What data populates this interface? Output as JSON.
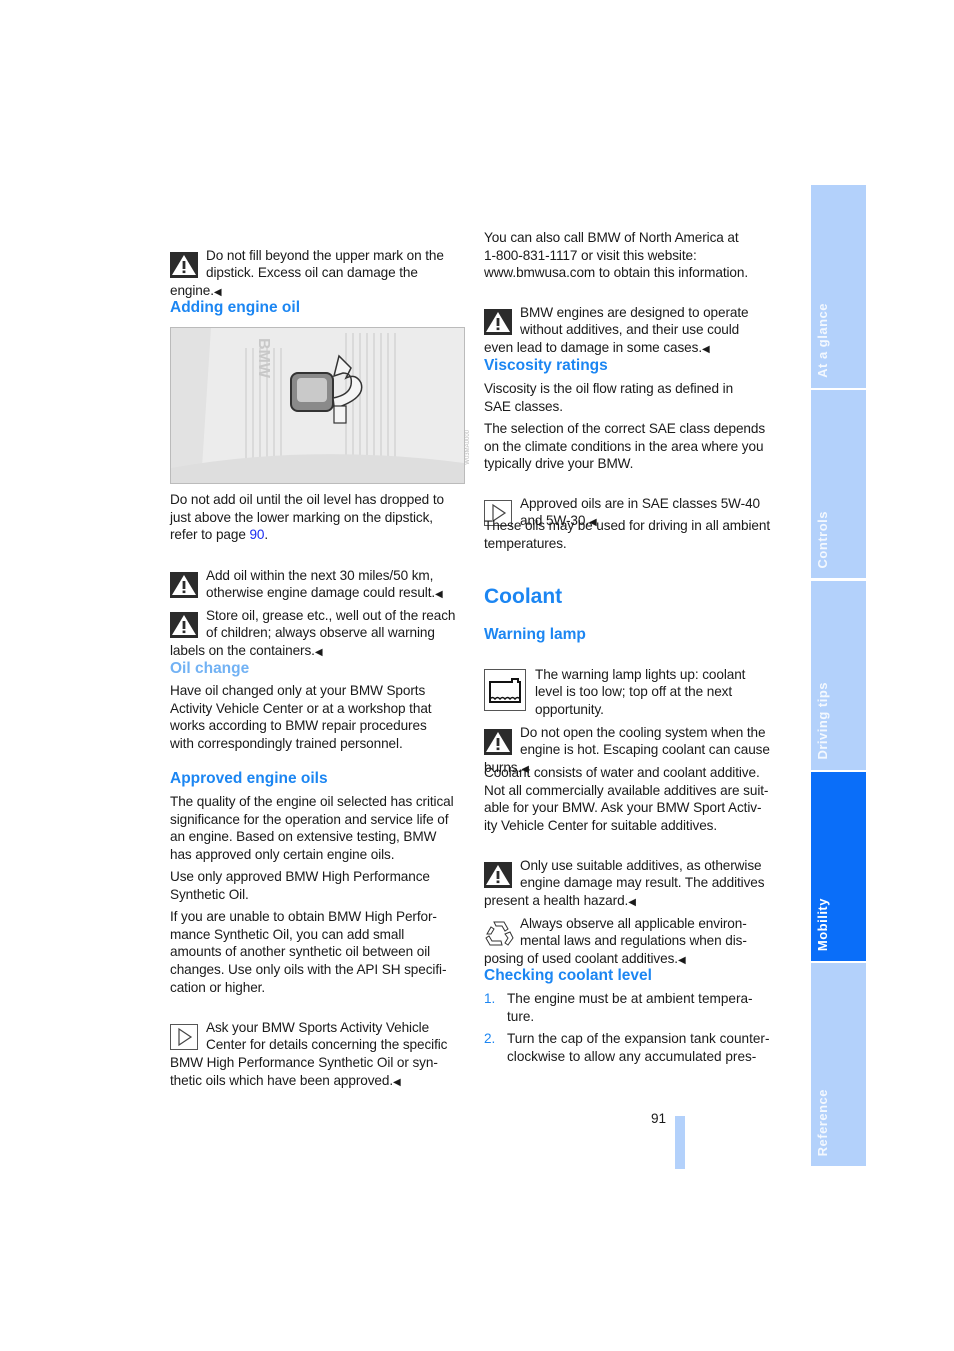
{
  "left": {
    "note_dipstick": "Do not fill beyond the upper mark on the\ndipstick. Excess oil can damage the\nengine.",
    "heading_adding": "Adding engine oil",
    "image_watermark": "W03MA0000",
    "para_add_pre": "Do not add oil until the oil level has dropped to\njust above the lower marking on the dipstick,\nrefer to page ",
    "para_add_link": "90",
    "para_add_post": ".",
    "note_miles": "Add oil within the next 30 miles/50 km,\notherwise engine damage could result.",
    "note_store": "Store oil, grease etc., well out of the reach\nof children; always observe all warning\nlabels on the containers.",
    "heading_oil_change": "Oil change",
    "para_oil_change": "Have oil changed only at your BMW Sports\nActivity Vehicle Center or at a workshop that\nworks according to BMW repair procedures\nwith correspondingly trained personnel.",
    "heading_approved": "Approved engine oils",
    "para_quality": "The quality of the engine oil selected has critical\nsignificance for the operation and service life of\nan engine. Based on extensive testing, BMW\nhas approved only certain engine oils.",
    "para_use_only": "Use only approved BMW High Performance\nSynthetic Oil.",
    "para_unable": "If you are unable to obtain BMW High Perfor-\nmance Synthetic Oil, you can add small\namounts of another synthetic oil between oil\nchanges. Use only oils with the API SH specifi-\ncation or higher.",
    "note_ask": "Ask your BMW Sports Activity Vehicle\nCenter for details concerning the specific\nBMW High Performance Synthetic Oil or syn-\nthetic oils which have been approved."
  },
  "right": {
    "para_call": "You can also call BMW of North America at\n1-800-831-1117 or visit this website:\nwww.bmwusa.com to obtain this information.",
    "note_additives": "BMW engines are designed to operate\nwithout additives, and their use could\neven lead to damage in some cases.",
    "heading_viscosity": "Viscosity ratings",
    "para_viscosity": "Viscosity is the oil flow rating as defined in\nSAE classes.",
    "para_selection": "The selection of the correct SAE class depends\non the climate conditions in the area where you\ntypically drive your BMW.",
    "note_approved_classes": "Approved oils are in SAE classes 5W-40\nand 5W-30.",
    "para_ambient": "These oils may be used for driving in all ambient\ntemperatures.",
    "heading_coolant": "Coolant",
    "heading_warning_lamp": "Warning lamp",
    "note_lamp": "The warning lamp lights up: coolant\nlevel is too low; top off at the next\nopportunity.",
    "note_hot": "Do not open the cooling system when the\nengine is hot. Escaping coolant can cause\nburns.",
    "para_consists": "Coolant consists of water and coolant additive.\nNot all commercially available additives are suit-\nable for your BMW. Ask your BMW Sport Activ-\nity Vehicle Center for suitable additives.",
    "note_suitable": "Only use suitable additives, as otherwise\nengine damage may result. The additives\npresent a health hazard.",
    "note_environment": "Always observe all applicable environ-\nmental laws and regulations when dis-\nposing of used coolant additives.",
    "heading_checking": "Checking coolant level",
    "steps": [
      {
        "num": "1.",
        "text": "The engine must be at ambient tempera-\nture."
      },
      {
        "num": "2.",
        "text": "Turn the cap of the expansion tank counter-\nclockwise to allow any accumulated pres-"
      }
    ]
  },
  "end_mark": "◀",
  "page_number": "91",
  "side_tabs": [
    {
      "label": "At a glance",
      "active": false
    },
    {
      "label": "Controls",
      "active": false
    },
    {
      "label": "Driving tips",
      "active": false
    },
    {
      "label": "Mobility",
      "active": true
    },
    {
      "label": "Reference",
      "active": false
    }
  ],
  "colors": {
    "heading": "#1c86f2",
    "tab": "#b3d1fb",
    "tab_active": "#0a6ef9",
    "link": "#1c2cf2"
  }
}
